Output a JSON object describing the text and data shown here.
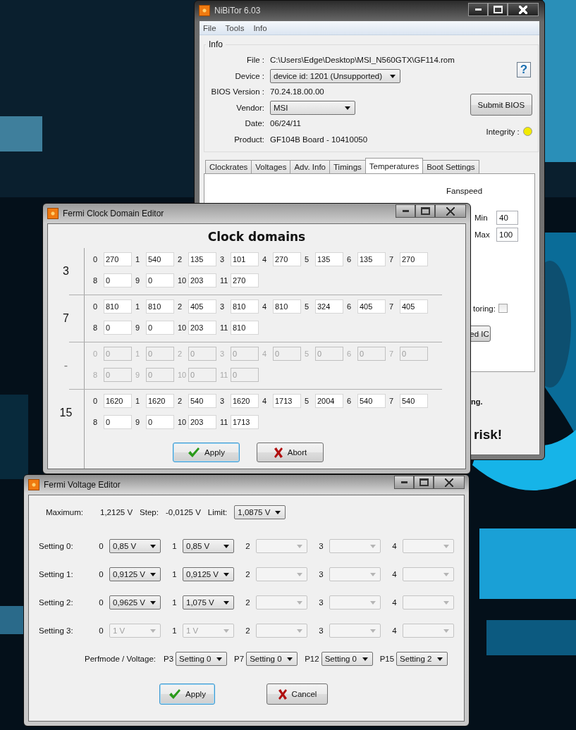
{
  "main_window": {
    "title": "NiBiTor 6.03",
    "menu": [
      "File",
      "Tools",
      "Info"
    ],
    "info": {
      "legend": "Info",
      "rows": [
        {
          "label": "File :",
          "value": "C:\\Users\\Edge\\Desktop\\MSI_N560GTX\\GF114.rom",
          "kind": "text"
        },
        {
          "label": "Device :",
          "value": "device id: 1201 (Unsupported)",
          "kind": "select"
        },
        {
          "label": "BIOS Version :",
          "value": "70.24.18.00.00",
          "kind": "text"
        },
        {
          "label": "Vendor:",
          "value": "MSI",
          "kind": "select"
        },
        {
          "label": "Date:",
          "value": "06/24/11",
          "kind": "text"
        },
        {
          "label": "Product:",
          "value": "GF104B Board - 10410050",
          "kind": "text"
        }
      ],
      "help": "?",
      "submit": "Submit BIOS",
      "integrity": {
        "label": "Integrity :",
        "color": "#f2ea00"
      }
    },
    "tabs": [
      {
        "label": "Clockrates",
        "selected": false
      },
      {
        "label": "Voltages",
        "selected": false
      },
      {
        "label": "Adv. Info",
        "selected": false
      },
      {
        "label": "Timings",
        "selected": false
      },
      {
        "label": "Temperatures",
        "selected": true
      },
      {
        "label": "Boot Settings",
        "selected": false
      }
    ],
    "temperatures": {
      "fanspeed_label": "Fanspeed",
      "min_label": "Min",
      "min": "40",
      "max_label": "Max",
      "max": "100",
      "monitoring_label": "toring:",
      "monitoring_checked": false,
      "ic_button": "ed IC"
    },
    "notes": [
      "ng.",
      "risk!"
    ]
  },
  "clock_editor": {
    "title": "Fermi Clock Domain Editor",
    "heading": "Clock domains",
    "domains": [
      {
        "label": "3",
        "disabled": false,
        "fields": [
          {
            "n": "0",
            "v": "270"
          },
          {
            "n": "1",
            "v": "540"
          },
          {
            "n": "2",
            "v": "135"
          },
          {
            "n": "3",
            "v": "101"
          },
          {
            "n": "4",
            "v": "270"
          },
          {
            "n": "5",
            "v": "135"
          },
          {
            "n": "6",
            "v": "135"
          },
          {
            "n": "7",
            "v": "270"
          },
          {
            "n": "8",
            "v": "0"
          },
          {
            "n": "9",
            "v": "0"
          },
          {
            "n": "10",
            "v": "203"
          },
          {
            "n": "11",
            "v": "270"
          }
        ]
      },
      {
        "label": "7",
        "disabled": false,
        "fields": [
          {
            "n": "0",
            "v": "810"
          },
          {
            "n": "1",
            "v": "810"
          },
          {
            "n": "2",
            "v": "405"
          },
          {
            "n": "3",
            "v": "810"
          },
          {
            "n": "4",
            "v": "810"
          },
          {
            "n": "5",
            "v": "324"
          },
          {
            "n": "6",
            "v": "405"
          },
          {
            "n": "7",
            "v": "405"
          },
          {
            "n": "8",
            "v": "0"
          },
          {
            "n": "9",
            "v": "0"
          },
          {
            "n": "10",
            "v": "203"
          },
          {
            "n": "11",
            "v": "810"
          }
        ]
      },
      {
        "label": "-",
        "disabled": true,
        "fields": [
          {
            "n": "0",
            "v": "0"
          },
          {
            "n": "1",
            "v": "0"
          },
          {
            "n": "2",
            "v": "0"
          },
          {
            "n": "3",
            "v": "0"
          },
          {
            "n": "4",
            "v": "0"
          },
          {
            "n": "5",
            "v": "0"
          },
          {
            "n": "6",
            "v": "0"
          },
          {
            "n": "7",
            "v": "0"
          },
          {
            "n": "8",
            "v": "0"
          },
          {
            "n": "9",
            "v": "0"
          },
          {
            "n": "10",
            "v": "0"
          },
          {
            "n": "11",
            "v": "0"
          }
        ]
      },
      {
        "label": "15",
        "disabled": false,
        "fields": [
          {
            "n": "0",
            "v": "1620"
          },
          {
            "n": "1",
            "v": "1620"
          },
          {
            "n": "2",
            "v": "540"
          },
          {
            "n": "3",
            "v": "1620"
          },
          {
            "n": "4",
            "v": "1713"
          },
          {
            "n": "5",
            "v": "2004"
          },
          {
            "n": "6",
            "v": "540"
          },
          {
            "n": "7",
            "v": "540"
          },
          {
            "n": "8",
            "v": "0"
          },
          {
            "n": "9",
            "v": "0"
          },
          {
            "n": "10",
            "v": "203"
          },
          {
            "n": "11",
            "v": "1713"
          }
        ]
      }
    ],
    "buttons": [
      {
        "label": "Apply",
        "kind": "apply",
        "default": true
      },
      {
        "label": "Abort",
        "kind": "cancel",
        "default": false
      }
    ]
  },
  "voltage_editor": {
    "title": "Fermi Voltage Editor",
    "maximum_label": "Maximum:",
    "maximum": "1,2125 V",
    "step_label": "Step:",
    "step": "-0,0125 V",
    "limit_label": "Limit:",
    "limit": "1,0875 V",
    "settings": [
      {
        "label": "Setting 0:",
        "slots": [
          {
            "n": "0",
            "value": "0,85 V",
            "disabled": false
          },
          {
            "n": "1",
            "value": "0,85 V",
            "disabled": false
          },
          {
            "n": "2",
            "disabled": true
          },
          {
            "n": "3",
            "disabled": true
          },
          {
            "n": "4",
            "disabled": true
          }
        ]
      },
      {
        "label": "Setting 1:",
        "slots": [
          {
            "n": "0",
            "value": "0,9125 V",
            "disabled": false
          },
          {
            "n": "1",
            "value": "0,9125 V",
            "disabled": false
          },
          {
            "n": "2",
            "disabled": true
          },
          {
            "n": "3",
            "disabled": true
          },
          {
            "n": "4",
            "disabled": true
          }
        ]
      },
      {
        "label": "Setting 2:",
        "slots": [
          {
            "n": "0",
            "value": "0,9625 V",
            "disabled": false
          },
          {
            "n": "1",
            "value": "1,075 V",
            "disabled": false
          },
          {
            "n": "2",
            "disabled": true
          },
          {
            "n": "3",
            "disabled": true
          },
          {
            "n": "4",
            "disabled": true
          }
        ]
      },
      {
        "label": "Setting 3:",
        "slots": [
          {
            "n": "0",
            "value": "1 V",
            "disabled": true
          },
          {
            "n": "1",
            "value": "1 V",
            "disabled": true
          },
          {
            "n": "2",
            "disabled": true
          },
          {
            "n": "3",
            "disabled": true
          },
          {
            "n": "4",
            "disabled": true
          }
        ]
      }
    ],
    "perf_label": "Perfmode / Voltage:",
    "perf": [
      {
        "label": "P3",
        "value": "Setting 0"
      },
      {
        "label": "P7",
        "value": "Setting 0"
      },
      {
        "label": "P12",
        "value": "Setting 0"
      },
      {
        "label": "P15",
        "value": "Setting 2"
      }
    ],
    "buttons": [
      {
        "label": "Apply",
        "kind": "apply",
        "default": true
      },
      {
        "label": "Cancel",
        "kind": "cancel",
        "default": false
      }
    ]
  }
}
